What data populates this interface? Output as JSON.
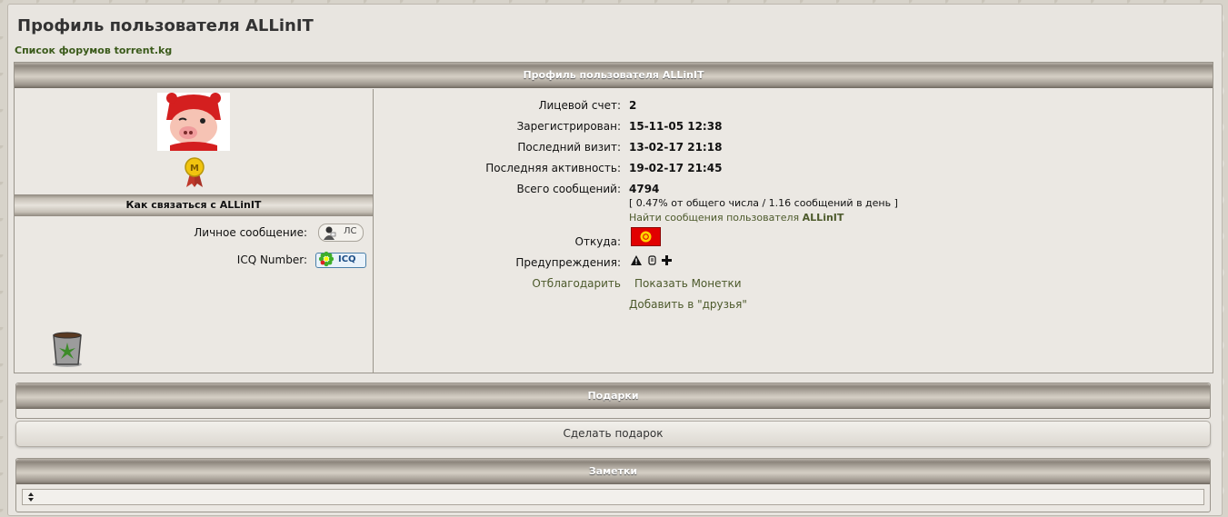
{
  "page": {
    "title": "Профиль пользователя ALLinIT",
    "breadcrumb": "Список форумов torrent.kg"
  },
  "profile": {
    "header": "Профиль пользователя ALLinIT",
    "avatar_icon": "pig-avatar",
    "rank_icon": "medal-icon",
    "contact": {
      "header": "Как связаться с ALLinIT",
      "pm_label": "Личное сообщение:",
      "pm_button": "ЛС",
      "icq_label": "ICQ Number:",
      "icq_button": "ICQ"
    },
    "info": {
      "account_label": "Лицевой счет:",
      "account_value": "2",
      "registered_label": "Зарегистрирован:",
      "registered_value": "15-11-05 12:38",
      "last_visit_label": "Последний визит:",
      "last_visit_value": "13-02-17 21:18",
      "last_activity_label": "Последняя активность:",
      "last_activity_value": "19-02-17 21:45",
      "posts_label": "Всего сообщений:",
      "posts_value": "4794",
      "posts_stats": "[ 0.47% от общего числа / 1.16 сообщений в день ]",
      "find_posts_text": "Найти сообщения пользователя ",
      "find_posts_user": "ALLinIT",
      "from_label": "Откуда:",
      "warnings_label": "Предупреждения:",
      "thank_label": "Отблагодарить",
      "show_coins": "Показать Монетки",
      "add_friend": "Добавить в \"друзья\""
    }
  },
  "gifts": {
    "header": "Подарки",
    "button": "Сделать подарок"
  },
  "notes": {
    "header": "Заметки"
  },
  "colors": {
    "link": "#4d5a2c",
    "flag_red": "#e10000",
    "flag_sun": "#ffd200"
  }
}
